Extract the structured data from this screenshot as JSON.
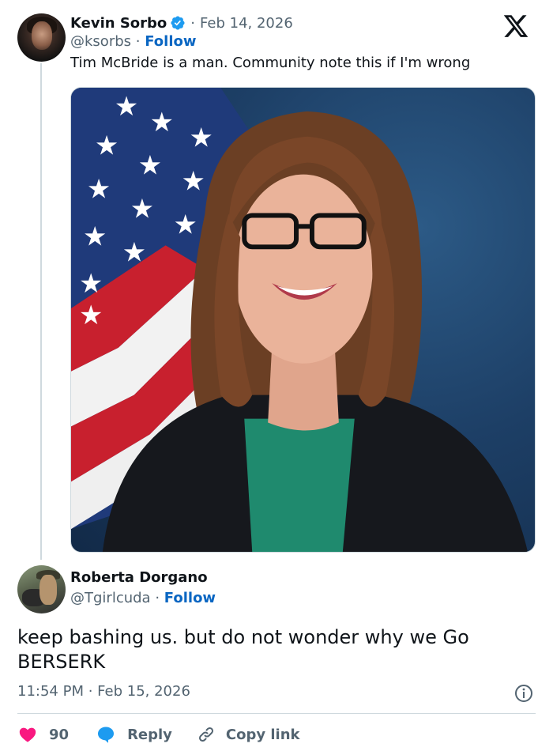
{
  "parent": {
    "name": "Kevin Sorbo",
    "date": "Feb 14, 2026",
    "handle": "@ksorbs",
    "separator": "·",
    "follow_label": "Follow",
    "text": "Tim McBride is a man. Community note this if I'm wrong"
  },
  "reply": {
    "name": "Roberta Dorgano",
    "handle": "@Tgirlcuda",
    "separator": "·",
    "follow_label": "Follow",
    "text": "keep bashing us. but do not wonder why we Go BERSERK",
    "timestamp": "11:54 PM · Feb 15, 2026"
  },
  "actions": {
    "like_count": "90",
    "reply_label": "Reply",
    "copy_label": "Copy link"
  },
  "icons": {
    "verified": "verified-badge-icon",
    "logo": "x-logo-icon",
    "info": "info-icon",
    "heart": "heart-icon",
    "reply": "speech-bubble-icon",
    "link": "link-icon"
  },
  "colors": {
    "accent": "#0a66c2",
    "verified": "#1d9bf0",
    "heart": "#f91880",
    "muted": "#536471",
    "text": "#0f1419",
    "divider": "#cfd9de"
  }
}
